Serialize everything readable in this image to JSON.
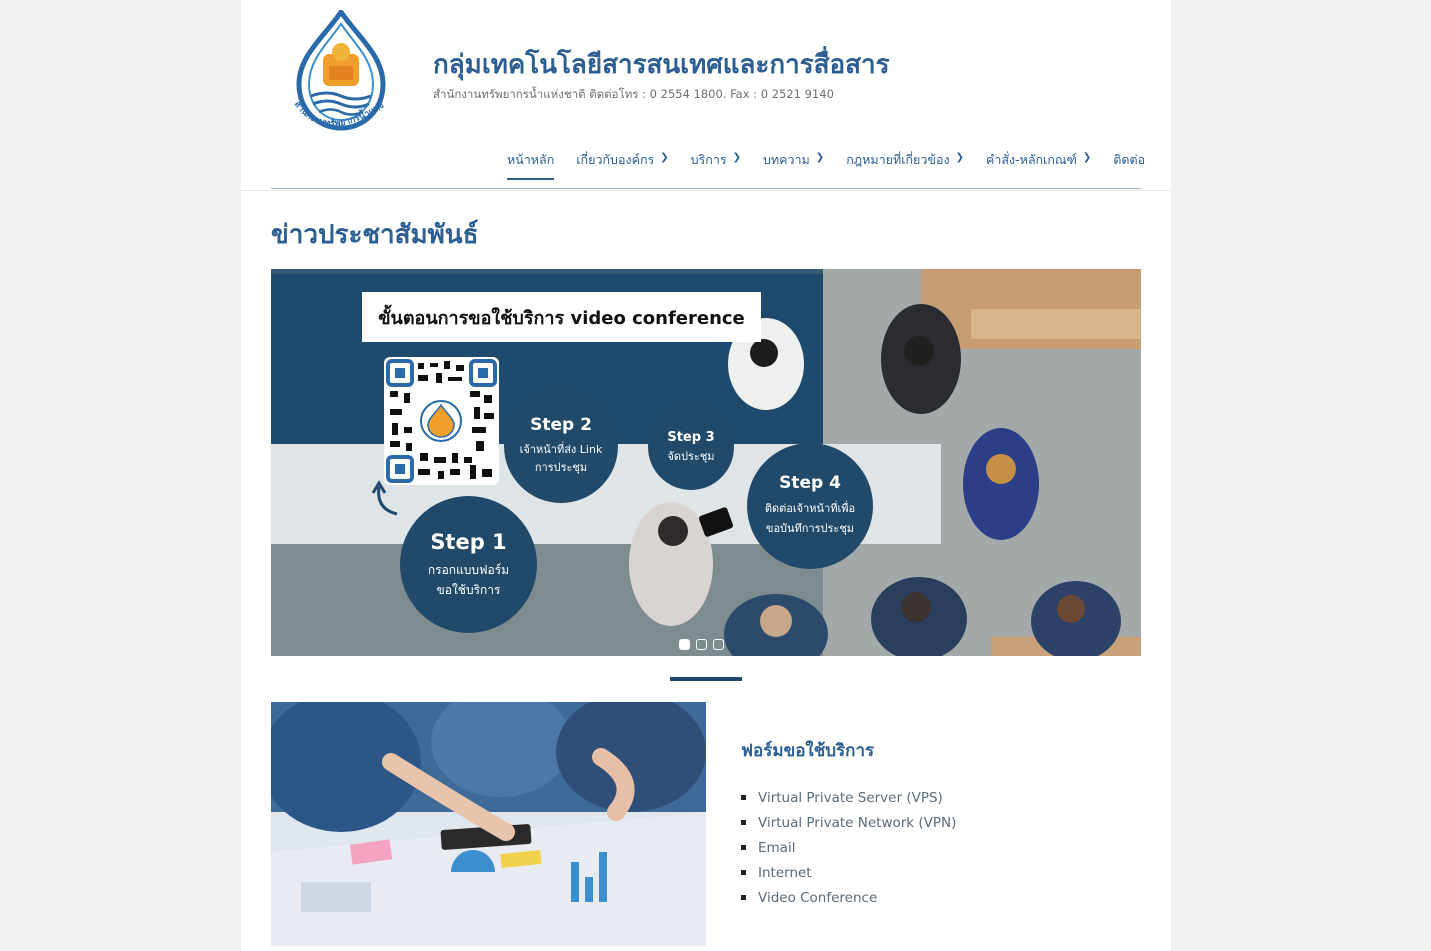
{
  "site": {
    "title": "กลุ่มเทคโนโลยีสารสนเทศและการสื่อสาร",
    "description": "สำนักงานทรัพยากรน้ำแห่งชาติ ติดต่อโทร : 0 2554 1800. Fax : 0 2521 9140",
    "logo_text": "สำนักงานทรัพยากรน้ำแห่งชาติ"
  },
  "nav": {
    "items": [
      {
        "label": "หน้าหลัก",
        "has_dropdown": false,
        "active": true
      },
      {
        "label": "เกี่ยวกับองค์กร",
        "has_dropdown": true
      },
      {
        "label": "บริการ",
        "has_dropdown": true
      },
      {
        "label": "บทความ",
        "has_dropdown": true
      },
      {
        "label": "กฎหมายที่เกี่ยวข้อง",
        "has_dropdown": true
      },
      {
        "label": "คำสั่ง-หลักเกณฑ์",
        "has_dropdown": true
      },
      {
        "label": "ติดต่อ",
        "has_dropdown": false
      }
    ],
    "chevron_icon": "chevron-down-icon"
  },
  "news": {
    "heading": "ข่าวประชาสัมพันธ์",
    "slide": {
      "title": "ขั้นตอนการขอใช้บริการ video conference",
      "steps": [
        {
          "title": "Step 1",
          "desc_1": "กรอกแบบฟอร์ม",
          "desc_2": "ขอใช้บริการ"
        },
        {
          "title": "Step 2",
          "desc_1": "เจ้าหน้าที่ส่ง Link",
          "desc_2": "การประชุม"
        },
        {
          "title": "Step 3",
          "desc_1": "จัดประชุม",
          "desc_2": ""
        },
        {
          "title": "Step 4",
          "desc_1": "ติดต่อเจ้าหน้าที่เพื่อ",
          "desc_2": "ขอบันทึการประชุม"
        }
      ]
    },
    "slider_total": 3,
    "slider_current": 1
  },
  "services": {
    "title": "ฟอร์มขอใช้บริการ",
    "items": [
      "Virtual Private Server (VPS)",
      "Virtual Private Network (VPN)",
      "Email",
      "Internet",
      "Video Conference"
    ]
  },
  "colors": {
    "brand_blue": "#2d5f93",
    "dark_navy": "#214a6a",
    "page_bg": "#f1f1f2"
  }
}
